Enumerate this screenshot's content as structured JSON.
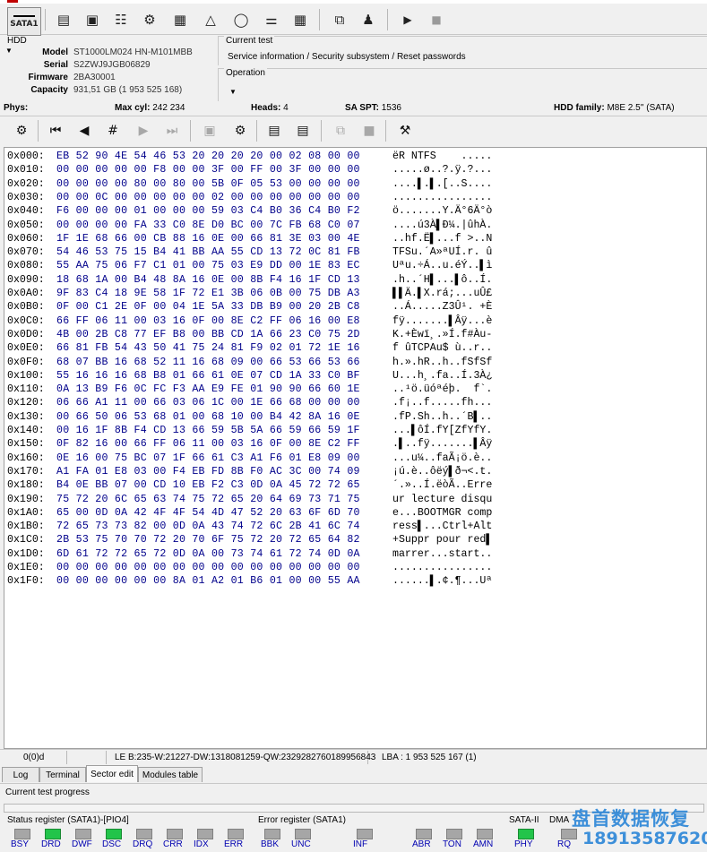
{
  "toolbar": {
    "sata_label": "SATA1",
    "icons": [
      "sata-port-icon",
      "report-icon",
      "drive-info-icon",
      "smart-icon",
      "settings-gear-icon",
      "chip-icon",
      "graph-icon",
      "disk-icon",
      "head-map-icon",
      "grid-table-icon",
      "copy-windows-icon",
      "walk-person-icon",
      "play-icon",
      "stop-icon"
    ]
  },
  "hdd": {
    "legend": "HDD",
    "model_label": "Model",
    "model": "ST1000LM024 HN-M101MBB",
    "serial_label": "Serial",
    "serial": "S2ZWJ9JGB06829",
    "firmware_label": "Firmware",
    "firmware": "2BA30001",
    "capacity_label": "Capacity",
    "capacity": "931,51 GB (1 953 525 168)"
  },
  "current_test": {
    "legend": "Current test",
    "value": "Service information / Security subsystem / Reset passwords"
  },
  "operation": {
    "legend": "Operation",
    "value": ""
  },
  "phys": {
    "label": "Phys:",
    "maxcyl_label": "Max cyl:",
    "maxcyl": "242 234",
    "heads_label": "Heads:",
    "heads": "4",
    "saspt_label": "SA SPT:",
    "saspt": "1536",
    "family_label": "HDD family:",
    "family": "M8E 2.5'' (SATA)"
  },
  "hex": {
    "rows": [
      {
        "off": "0x000:",
        "hex": "EB 52 90 4E 54 46 53 20 20 20 20 00 02 08 00 00",
        "asc": "ëR NTFS    ....."
      },
      {
        "off": "0x010:",
        "hex": "00 00 00 00 00 F8 00 00 3F 00 FF 00 3F 00 00 00",
        "asc": ".....ø..?.ÿ.?..."
      },
      {
        "off": "0x020:",
        "hex": "00 00 00 00 80 00 80 00 5B 0F 05 53 00 00 00 00",
        "asc": "....▌.▌.[..S...."
      },
      {
        "off": "0x030:",
        "hex": "00 00 0C 00 00 00 00 00 02 00 00 00 00 00 00 00",
        "asc": "................"
      },
      {
        "off": "0x040:",
        "hex": "F6 00 00 00 01 00 00 00 59 03 C4 B0 36 C4 B0 F2",
        "asc": "ö.......Y.Ä°6Ä°ò"
      },
      {
        "off": "0x050:",
        "hex": "00 00 00 00 FA 33 C0 8E D0 BC 00 7C FB 68 C0 07",
        "asc": "....ú3À▌Ð¼.|ûhÀ."
      },
      {
        "off": "0x060:",
        "hex": "1F 1E 68 66 00 CB 88 16 0E 00 66 81 3E 03 00 4E",
        "asc": "..hf.Ë▌...f >..N"
      },
      {
        "off": "0x070:",
        "hex": "54 46 53 75 15 B4 41 BB AA 55 CD 13 72 0C 81 FB",
        "asc": "TFSu.´A»ªUÍ.r. û"
      },
      {
        "off": "0x080:",
        "hex": "55 AA 75 06 F7 C1 01 00 75 03 E9 DD 00 1E 83 EC",
        "asc": "Uªu.÷Á..u.éÝ..▌ì"
      },
      {
        "off": "0x090:",
        "hex": "18 68 1A 00 B4 48 8A 16 0E 00 8B F4 16 1F CD 13",
        "asc": ".h..´H▌...▌ô..Í."
      },
      {
        "off": "0x0A0:",
        "hex": "9F 83 C4 18 9E 58 1F 72 E1 3B 06 0B 00 75 DB A3",
        "asc": "▌▌Ä.▌X.rá;...uÛ£"
      },
      {
        "off": "0x0B0:",
        "hex": "0F 00 C1 2E 0F 00 04 1E 5A 33 DB B9 00 20 2B C8",
        "asc": "..Á.....Z3Û¹. +È"
      },
      {
        "off": "0x0C0:",
        "hex": "66 FF 06 11 00 03 16 0F 00 8E C2 FF 06 16 00 E8",
        "asc": "fÿ.......▌Âÿ...è"
      },
      {
        "off": "0x0D0:",
        "hex": "4B 00 2B C8 77 EF B8 00 BB CD 1A 66 23 C0 75 2D",
        "asc": "K.+Èwï¸.»Í.f#Àu-"
      },
      {
        "off": "0x0E0:",
        "hex": "66 81 FB 54 43 50 41 75 24 81 F9 02 01 72 1E 16",
        "asc": "f ûTCPAu$ ù..r.."
      },
      {
        "off": "0x0F0:",
        "hex": "68 07 BB 16 68 52 11 16 68 09 00 66 53 66 53 66",
        "asc": "h.».hR..h..fSfSf"
      },
      {
        "off": "0x100:",
        "hex": "55 16 16 16 68 B8 01 66 61 0E 07 CD 1A 33 C0 BF",
        "asc": "U...h¸.fa..Í.3À¿"
      },
      {
        "off": "0x110:",
        "hex": "0A 13 B9 F6 0C FC F3 AA E9 FE 01 90 90 66 60 1E",
        "asc": "..¹ö.üóªéþ.  f`."
      },
      {
        "off": "0x120:",
        "hex": "06 66 A1 11 00 66 03 06 1C 00 1E 66 68 00 00 00",
        "asc": ".f¡..f.....fh..."
      },
      {
        "off": "0x130:",
        "hex": "00 66 50 06 53 68 01 00 68 10 00 B4 42 8A 16 0E",
        "asc": ".fP.Sh..h..´B▌.."
      },
      {
        "off": "0x140:",
        "hex": "00 16 1F 8B F4 CD 13 66 59 5B 5A 66 59 66 59 1F",
        "asc": "...▌ôÍ.fY[ZfYfY."
      },
      {
        "off": "0x150:",
        "hex": "0F 82 16 00 66 FF 06 11 00 03 16 0F 00 8E C2 FF",
        "asc": ".▌..fÿ.......▌Âÿ"
      },
      {
        "off": "0x160:",
        "hex": "0E 16 00 75 BC 07 1F 66 61 C3 A1 F6 01 E8 09 00",
        "asc": "...u¼..faÃ¡ö.è.."
      },
      {
        "off": "0x170:",
        "hex": "A1 FA 01 E8 03 00 F4 EB FD 8B F0 AC 3C 00 74 09",
        "asc": "¡ú.è..ôëý▌ð¬<.t."
      },
      {
        "off": "0x180:",
        "hex": "B4 0E BB 07 00 CD 10 EB F2 C3 0D 0A 45 72 72 65",
        "asc": "´.»..Í.ëòÃ..Erre"
      },
      {
        "off": "0x190:",
        "hex": "75 72 20 6C 65 63 74 75 72 65 20 64 69 73 71 75",
        "asc": "ur lecture disqu"
      },
      {
        "off": "0x1A0:",
        "hex": "65 00 0D 0A 42 4F 4F 54 4D 47 52 20 63 6F 6D 70",
        "asc": "e...BOOTMGR comp"
      },
      {
        "off": "0x1B0:",
        "hex": "72 65 73 73 82 00 0D 0A 43 74 72 6C 2B 41 6C 74",
        "asc": "ress▌...Ctrl+Alt"
      },
      {
        "off": "0x1C0:",
        "hex": "2B 53 75 70 70 72 20 70 6F 75 72 20 72 65 64 82",
        "asc": "+Suppr pour red▌"
      },
      {
        "off": "0x1D0:",
        "hex": "6D 61 72 72 65 72 0D 0A 00 73 74 61 72 74 0D 0A",
        "asc": "marrer...start.."
      },
      {
        "off": "0x1E0:",
        "hex": "00 00 00 00 00 00 00 00 00 00 00 00 00 00 00 00",
        "asc": "................"
      },
      {
        "off": "0x1F0:",
        "hex": "00 00 00 00 00 00 8A 01 A2 01 B6 01 00 00 55 AA",
        "asc": "......▌.¢.¶...Uª"
      }
    ]
  },
  "statusline": {
    "pos": "0(0)d",
    "le": "LE B:235-W:21227-DW:1318081259-QW:2329282760189956843",
    "lba": "LBA : 1 953 525 167 (1)"
  },
  "tabs": [
    "Log",
    "Terminal",
    "Sector edit",
    "Modules table"
  ],
  "active_tab": "Sector edit",
  "progress": {
    "label": "Current test progress"
  },
  "status_register": {
    "title": "Status register (SATA1)-[PIO4]",
    "leds": [
      {
        "name": "BSY",
        "on": false
      },
      {
        "name": "DRD",
        "on": true
      },
      {
        "name": "DWF",
        "on": false
      },
      {
        "name": "DSC",
        "on": true
      },
      {
        "name": "DRQ",
        "on": false
      },
      {
        "name": "CRR",
        "on": false
      },
      {
        "name": "IDX",
        "on": false
      },
      {
        "name": "ERR",
        "on": false
      }
    ]
  },
  "error_register": {
    "title": "Error register (SATA1)",
    "leds": [
      {
        "name": "BBK",
        "on": false
      },
      {
        "name": "UNC",
        "on": false
      },
      {
        "name": "INF",
        "on": false
      },
      {
        "name": "ABR",
        "on": false
      },
      {
        "name": "TON",
        "on": false
      },
      {
        "name": "AMN",
        "on": false
      }
    ]
  },
  "sata2": {
    "title": "SATA-II",
    "led": {
      "name": "PHY",
      "on": true
    }
  },
  "dma": {
    "title": "DMA",
    "led": {
      "name": "RQ",
      "on": false
    }
  },
  "watermark": {
    "line1": "盘首数据恢复",
    "line2": "18913587620"
  },
  "colors": {
    "hex_text": "#00008b",
    "led_on": "#22c44a",
    "led_off": "#a6a6a6",
    "watermark": "#1e7fd6"
  }
}
